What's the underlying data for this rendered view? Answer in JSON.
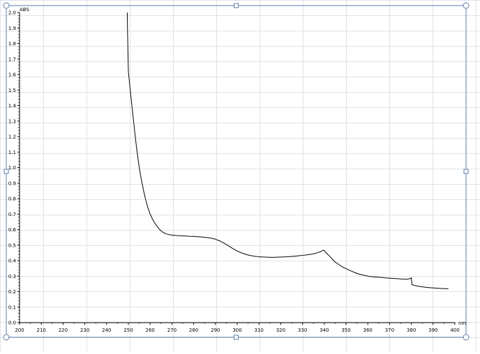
{
  "chart_data": {
    "type": "line",
    "ylabel": "ABS",
    "xlabel": "nm",
    "xlim": [
      200,
      400
    ],
    "ylim": [
      0.0,
      2.0
    ],
    "x_ticks": [
      200,
      210,
      220,
      230,
      240,
      250,
      260,
      270,
      280,
      290,
      300,
      310,
      320,
      330,
      340,
      350,
      360,
      370,
      380,
      390,
      400
    ],
    "y_ticks": [
      "0.0",
      "0.1",
      "0.2",
      "0.3",
      "0.4",
      "0.5",
      "0.6",
      "0.7",
      "0.8",
      "0.9",
      "1.0",
      "1.1",
      "1.2",
      "1.3",
      "1.4",
      "1.5",
      "1.6",
      "1.7",
      "1.8",
      "1.9",
      "2.0"
    ],
    "grid": true,
    "series": [
      {
        "color": "#000000",
        "x": [
          249.5,
          249.6,
          249.8,
          250.0,
          250.5,
          251.0,
          252.0,
          253.0,
          254.0,
          255.0,
          256.0,
          257.0,
          258.0,
          259.0,
          260.0,
          261.0,
          262.0,
          263.0,
          264.0,
          265.0,
          266.0,
          267.0,
          268.0,
          269.0,
          270.0,
          272.0,
          274.0,
          276.0,
          278.0,
          280.0,
          282.0,
          284.0,
          286.0,
          288.0,
          290.0,
          292.0,
          294.0,
          296.0,
          298.0,
          300.0,
          302.0,
          304.0,
          306.0,
          308.0,
          310.0,
          312.0,
          314.0,
          316.0,
          318.0,
          320.0,
          322.0,
          324.0,
          326.0,
          328.0,
          330.0,
          332.0,
          334.0,
          336.0,
          337.0,
          338.0,
          339.0,
          339.5,
          340.0,
          340.5,
          341.0,
          342.0,
          343.0,
          344.0,
          345.0,
          346.0,
          347.0,
          348.0,
          350.0,
          352.0,
          354.0,
          356.0,
          358.0,
          360.0,
          362.0,
          364.0,
          366.0,
          368.0,
          370.0,
          372.0,
          374.0,
          376.0,
          378.0,
          379.5,
          380.0,
          380.3,
          382.0,
          384.0,
          386.0,
          388.0,
          390.0,
          392.0,
          394.0,
          396.0,
          397.0
        ],
        "y": [
          2.0,
          1.9,
          1.75,
          1.62,
          1.55,
          1.48,
          1.35,
          1.22,
          1.1,
          1.0,
          0.92,
          0.85,
          0.79,
          0.74,
          0.7,
          0.67,
          0.645,
          0.625,
          0.607,
          0.592,
          0.582,
          0.575,
          0.57,
          0.567,
          0.565,
          0.562,
          0.56,
          0.559,
          0.557,
          0.556,
          0.554,
          0.552,
          0.549,
          0.545,
          0.538,
          0.527,
          0.512,
          0.495,
          0.478,
          0.462,
          0.45,
          0.44,
          0.433,
          0.428,
          0.425,
          0.423,
          0.422,
          0.421,
          0.422,
          0.423,
          0.424,
          0.426,
          0.428,
          0.431,
          0.434,
          0.437,
          0.441,
          0.447,
          0.452,
          0.456,
          0.462,
          0.468,
          0.465,
          0.455,
          0.447,
          0.435,
          0.42,
          0.405,
          0.39,
          0.382,
          0.372,
          0.362,
          0.348,
          0.335,
          0.323,
          0.313,
          0.306,
          0.3,
          0.296,
          0.294,
          0.292,
          0.289,
          0.287,
          0.285,
          0.283,
          0.281,
          0.28,
          0.284,
          0.29,
          0.245,
          0.238,
          0.233,
          0.229,
          0.226,
          0.224,
          0.222,
          0.22,
          0.219,
          0.218
        ]
      }
    ]
  }
}
